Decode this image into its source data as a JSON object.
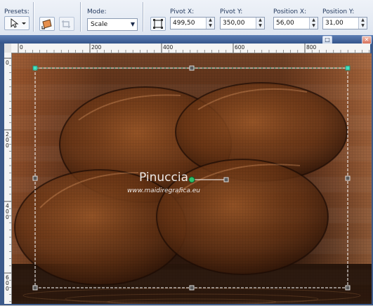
{
  "toolbar": {
    "presets_label": "Presets:",
    "mode_label": "Mode:",
    "mode_value": "Scale",
    "pivot_x_label": "Pivot X:",
    "pivot_x_value": "499,50",
    "pivot_y_label": "Pivot Y:",
    "pivot_y_value": "350,00",
    "position_x_label": "Position X:",
    "position_x_value": "56,00",
    "position_y_label": "Position Y:",
    "position_y_value": "31,00"
  },
  "window": {
    "close_glyph": "✕",
    "maximize_glyph": "□"
  },
  "ruler": {
    "h_labels": [
      "0",
      "200",
      "400",
      "600",
      "800"
    ],
    "v_labels": [
      "0",
      "200",
      "400",
      "600"
    ]
  },
  "canvas": {
    "watermark_title": "Pinuccia",
    "watermark_url": "www.maidiregrafica.eu",
    "colors": {
      "copper": "#8a4a1c",
      "dark": "#2a1408",
      "handle": "#5a5a5a",
      "pivot": "#2fbf6a",
      "guide": "#43e3c1"
    }
  }
}
